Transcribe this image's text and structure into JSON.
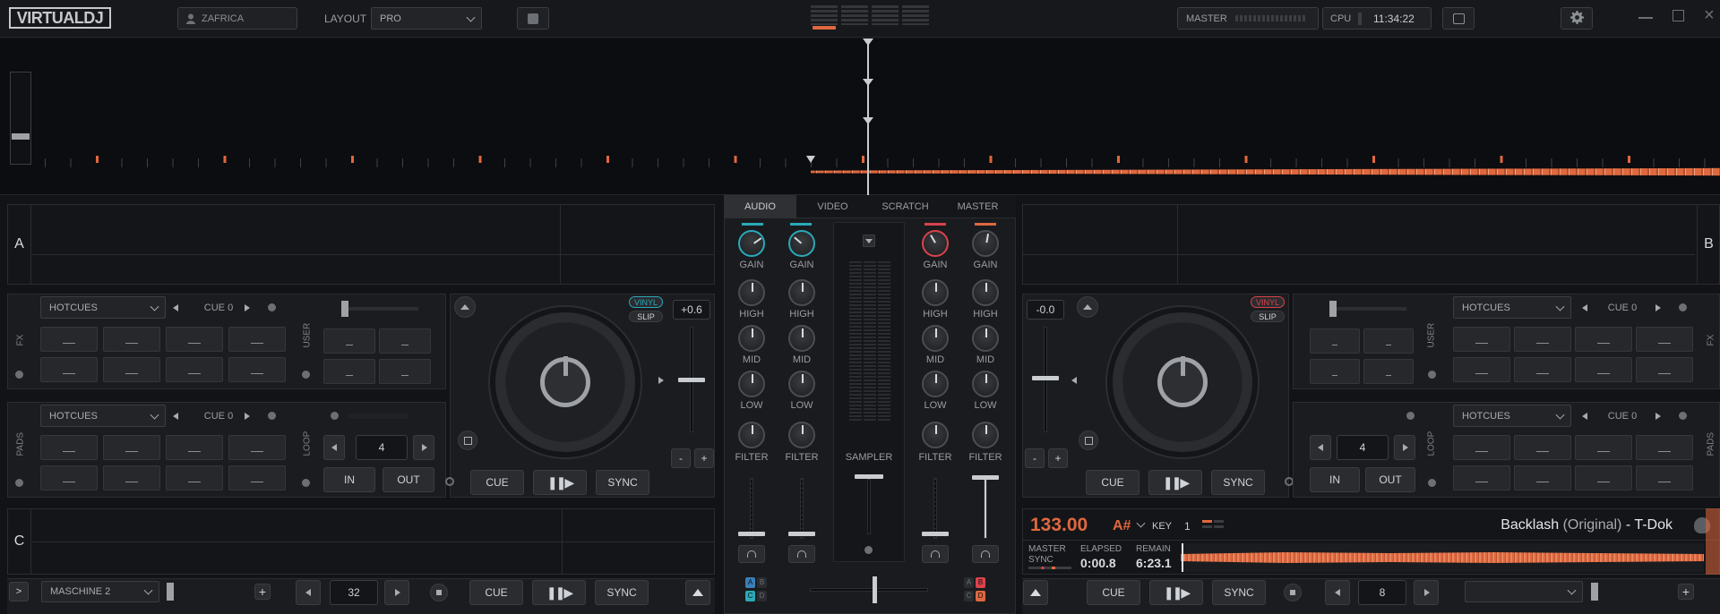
{
  "topbar": {
    "logo_text": "VIRTUALDJ",
    "user_label": "ZAFRICA",
    "layout_label": "LAYOUT",
    "layout_value": "PRO",
    "master_label": "MASTER",
    "cpu_label": "CPU",
    "clock": "11:34:22"
  },
  "mixer": {
    "tabs": [
      "AUDIO",
      "VIDEO",
      "SCRATCH",
      "MASTER"
    ],
    "gain_label": "GAIN",
    "high_label": "HIGH",
    "mid_label": "MID",
    "low_label": "LOW",
    "filter_label": "FILTER",
    "sampler_label": "SAMPLER",
    "routing_left": [
      "A",
      "B",
      "C",
      "D"
    ],
    "routing_right": [
      "A",
      "B",
      "C",
      "D"
    ]
  },
  "deck_a": {
    "letter": "A",
    "fx_label": "FX",
    "user_label": "USER",
    "pads_label": "PADS",
    "loop_label": "LOOP",
    "hotcues_top": "HOTCUES",
    "hotcues_bottom": "HOTCUES",
    "cue_top": "CUE 0",
    "cue_bottom": "CUE 0",
    "vinyl": "VINYL",
    "slip": "SLIP",
    "pitch": "+0.6",
    "minus": "-",
    "plus": "+",
    "loop_size": "4",
    "in": "IN",
    "out": "OUT",
    "cue": "CUE",
    "sync": "SYNC"
  },
  "deck_b": {
    "letter": "B",
    "fx_label": "FX",
    "user_label": "USER",
    "pads_label": "PADS",
    "loop_label": "LOOP",
    "hotcues_top": "HOTCUES",
    "hotcues_bottom": "HOTCUES",
    "cue_top": "CUE 0",
    "cue_bottom": "CUE 0",
    "vinyl": "VINYL",
    "slip": "SLIP",
    "pitch": "-0.0",
    "minus": "-",
    "plus": "+",
    "loop_size": "4",
    "in": "IN",
    "out": "OUT",
    "cue": "CUE",
    "sync": "SYNC",
    "bpm": "133.00",
    "key_value": "A#",
    "key_label": "KEY",
    "deck_number": "1",
    "track_title": "Backlash",
    "track_remix": "(Original)",
    "track_artist": "- T-Dok",
    "master_label": "MASTER",
    "sync_label": "SYNC",
    "elapsed_label": "ELAPSED",
    "elapsed_value": "0:00.8",
    "remain_label": "REMAIN",
    "remain_value": "6:23.1",
    "loop_size_bottom": "8"
  },
  "deck_c": {
    "letter": "C",
    "controller": "MASCHINE 2",
    "loop_size": "32",
    "cue": "CUE",
    "sync": "SYNC"
  },
  "colors": {
    "accent": "#e0683e",
    "teal": "#2aa9b8",
    "red": "#d9434b",
    "blue": "#3a7fb8"
  }
}
